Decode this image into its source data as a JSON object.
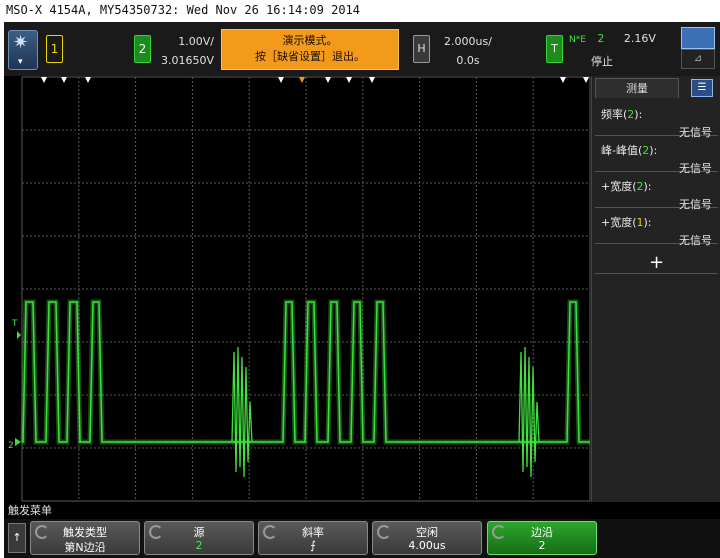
{
  "window_title": "MSO-X 4154A, MY54350732: Wed Nov 26 16:14:09 2014",
  "topbar": {
    "logo_caret": "▾",
    "channel1_label": "1",
    "channel2_label": "2",
    "channel2_scale": "1.00V/",
    "channel2_offset": "3.01650V",
    "demo_line1": "演示模式。",
    "demo_line2": "按［缺省设置］退出。",
    "horizontal_label": "H",
    "time_scale": "2.000us/",
    "time_delay": "0.0s",
    "trigger_label": "T",
    "trigger_mode": "N*E",
    "trigger_channel": "2",
    "trigger_level": "2.16V",
    "run_status": "停止"
  },
  "panel": {
    "tab_label": "测量",
    "measurements": [
      {
        "name": "频率",
        "channel": "2",
        "value": "无信号"
      },
      {
        "name": "峰-峰值",
        "channel": "2",
        "value": "无信号"
      },
      {
        "name": "+宽度",
        "channel": "2",
        "value": "无信号"
      },
      {
        "name": "+宽度",
        "channel": "1",
        "value": "无信号"
      }
    ],
    "add_label": "+"
  },
  "menu": {
    "title": "触发菜单",
    "back_label": "↑",
    "softkeys": [
      {
        "label": "触发类型",
        "value": "第N边沿"
      },
      {
        "label": "源",
        "value": "2"
      },
      {
        "label": "斜率",
        "value": "⨍"
      },
      {
        "label": "空闲",
        "value": "4.00us"
      },
      {
        "label": "边沿",
        "value": "2"
      }
    ]
  },
  "screen": {
    "ch1_marker": "T",
    "ch2_marker": "2",
    "colors": {
      "trace": "#3fe03f",
      "grid": "#5a5a5a",
      "background": "#000000"
    }
  }
}
